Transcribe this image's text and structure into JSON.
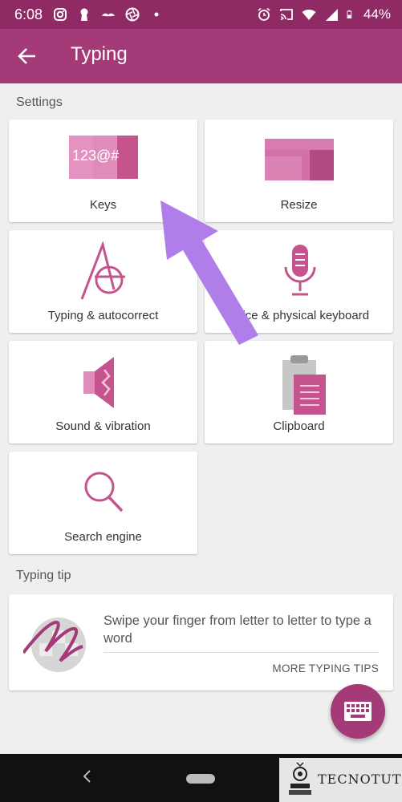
{
  "status_bar": {
    "time": "6:08",
    "battery": "44%",
    "left_icons": [
      "instagram-icon",
      "keyhole-icon",
      "mustache-icon",
      "aperture-icon",
      "dot-icon"
    ],
    "right_icons": [
      "alarm-icon",
      "cast-icon",
      "wifi-icon",
      "signal-icon",
      "battery-icon"
    ]
  },
  "app_bar": {
    "title": "Typing"
  },
  "sections": {
    "settings": "Settings",
    "typing_tip": "Typing tip"
  },
  "tiles": [
    {
      "label": "Keys",
      "icon": "keys-icon"
    },
    {
      "label": "Resize",
      "icon": "resize-icon"
    },
    {
      "label": "Typing & autocorrect",
      "icon": "typing-autocorrect-icon"
    },
    {
      "label": "Voice & physical keyboard",
      "icon": "microphone-icon"
    },
    {
      "label": "Sound & vibration",
      "icon": "speaker-icon"
    },
    {
      "label": "Clipboard",
      "icon": "clipboard-icon"
    },
    {
      "label": "Search engine",
      "icon": "search-icon"
    }
  ],
  "tip": {
    "text": "Swipe your finger from letter to letter to type a word",
    "more_label": "MORE TYPING TIPS"
  },
  "keys_art_text": "123@#",
  "watermark": "TECNOTUTO",
  "colors": {
    "accent": "#a43a78",
    "status_bar": "#8f2a64",
    "tile_pink": "#d4669f",
    "arrow": "#b07ee8"
  }
}
